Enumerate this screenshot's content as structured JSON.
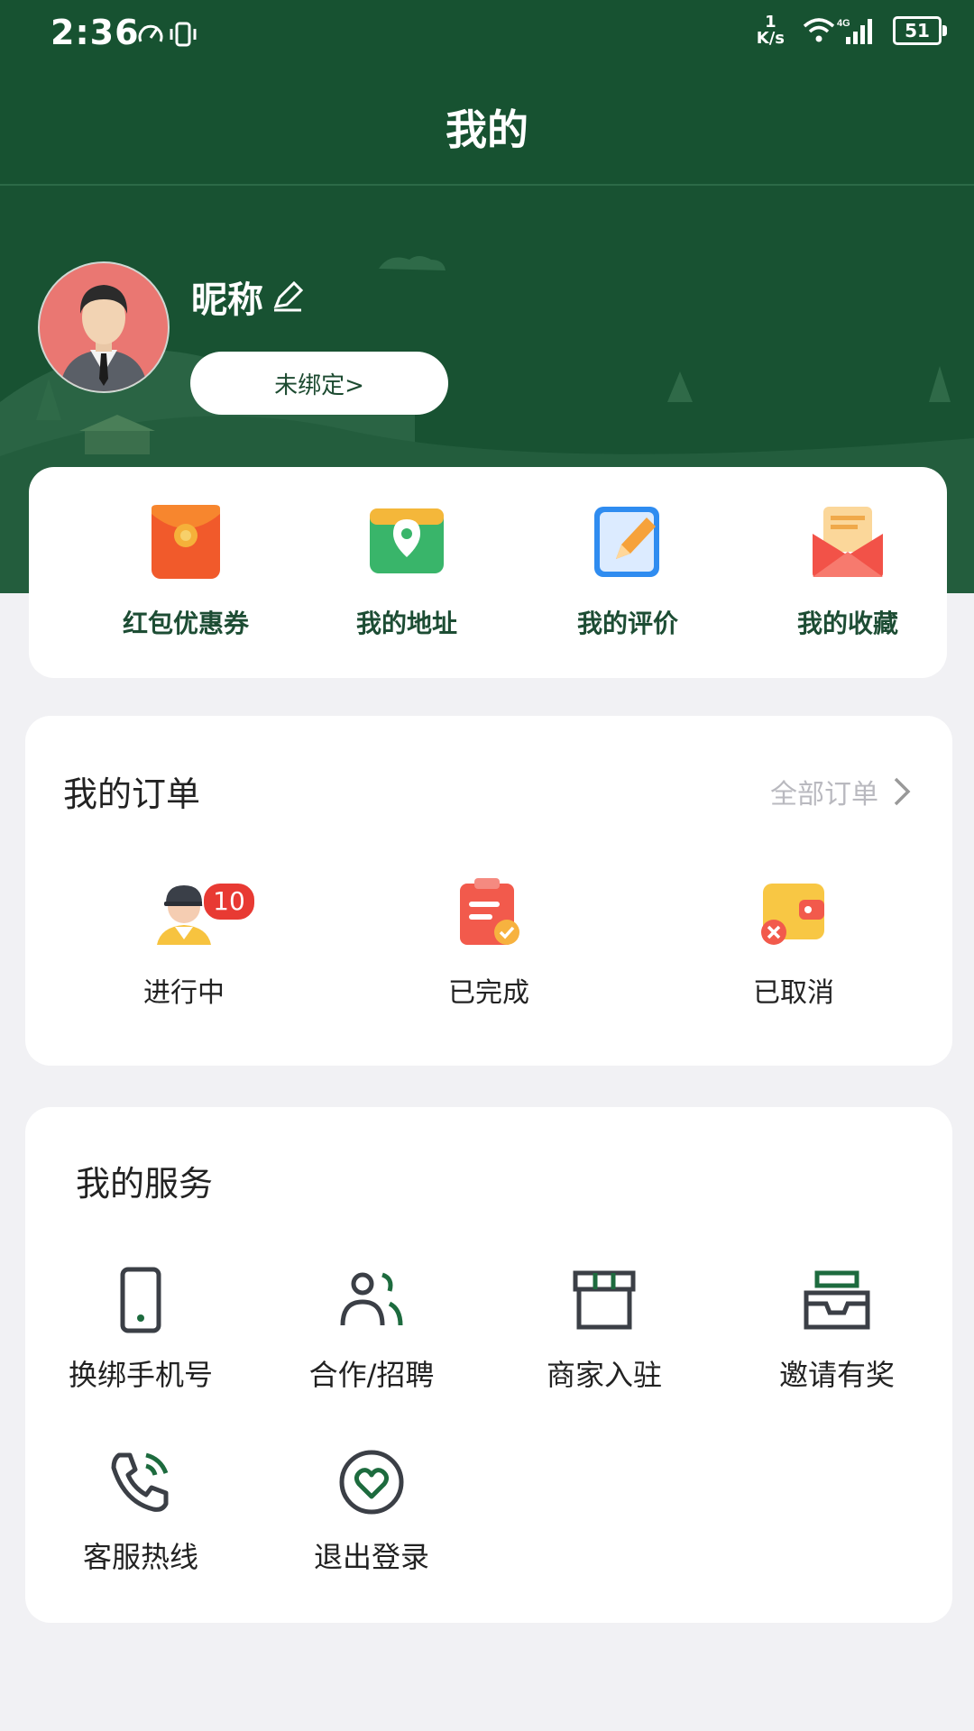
{
  "status_bar": {
    "time": "2:36",
    "net_speed_value": "1",
    "net_speed_unit": "K/s",
    "network": "4G",
    "battery": "51"
  },
  "title": "我的",
  "profile": {
    "nickname": "昵称",
    "bind_label": "未绑定>"
  },
  "quick_actions": [
    {
      "label": "红包优惠券",
      "icon": "red-envelope-icon"
    },
    {
      "label": "我的地址",
      "icon": "location-map-icon"
    },
    {
      "label": "我的评价",
      "icon": "edit-note-icon"
    },
    {
      "label": "我的收藏",
      "icon": "favorite-envelope-icon"
    }
  ],
  "orders": {
    "title": "我的订单",
    "all_label": "全部订单",
    "items": [
      {
        "label": "进行中",
        "badge": "10",
        "icon": "courier-icon"
      },
      {
        "label": "已完成",
        "icon": "clipboard-check-icon"
      },
      {
        "label": "已取消",
        "icon": "wallet-cancel-icon"
      }
    ]
  },
  "services": {
    "title": "我的服务",
    "items": [
      {
        "label": "换绑手机号",
        "icon": "phone-icon"
      },
      {
        "label": "合作/招聘",
        "icon": "people-icon"
      },
      {
        "label": "商家入驻",
        "icon": "store-icon"
      },
      {
        "label": "邀请有奖",
        "icon": "inbox-icon"
      },
      {
        "label": "客服热线",
        "icon": "phone-call-icon"
      },
      {
        "label": "退出登录",
        "icon": "heart-circle-icon"
      }
    ]
  },
  "colors": {
    "primary": "#175231",
    "accent_text": "#1d4d34",
    "badge": "#e83a33",
    "background": "#f1f1f4"
  }
}
